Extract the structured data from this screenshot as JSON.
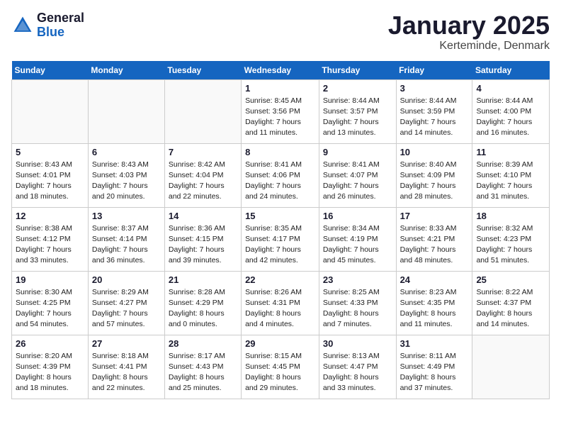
{
  "logo": {
    "general": "General",
    "blue": "Blue"
  },
  "title": "January 2025",
  "location": "Kerteminde, Denmark",
  "weekdays": [
    "Sunday",
    "Monday",
    "Tuesday",
    "Wednesday",
    "Thursday",
    "Friday",
    "Saturday"
  ],
  "weeks": [
    [
      {
        "day": "",
        "text": ""
      },
      {
        "day": "",
        "text": ""
      },
      {
        "day": "",
        "text": ""
      },
      {
        "day": "1",
        "text": "Sunrise: 8:45 AM\nSunset: 3:56 PM\nDaylight: 7 hours\nand 11 minutes."
      },
      {
        "day": "2",
        "text": "Sunrise: 8:44 AM\nSunset: 3:57 PM\nDaylight: 7 hours\nand 13 minutes."
      },
      {
        "day": "3",
        "text": "Sunrise: 8:44 AM\nSunset: 3:59 PM\nDaylight: 7 hours\nand 14 minutes."
      },
      {
        "day": "4",
        "text": "Sunrise: 8:44 AM\nSunset: 4:00 PM\nDaylight: 7 hours\nand 16 minutes."
      }
    ],
    [
      {
        "day": "5",
        "text": "Sunrise: 8:43 AM\nSunset: 4:01 PM\nDaylight: 7 hours\nand 18 minutes."
      },
      {
        "day": "6",
        "text": "Sunrise: 8:43 AM\nSunset: 4:03 PM\nDaylight: 7 hours\nand 20 minutes."
      },
      {
        "day": "7",
        "text": "Sunrise: 8:42 AM\nSunset: 4:04 PM\nDaylight: 7 hours\nand 22 minutes."
      },
      {
        "day": "8",
        "text": "Sunrise: 8:41 AM\nSunset: 4:06 PM\nDaylight: 7 hours\nand 24 minutes."
      },
      {
        "day": "9",
        "text": "Sunrise: 8:41 AM\nSunset: 4:07 PM\nDaylight: 7 hours\nand 26 minutes."
      },
      {
        "day": "10",
        "text": "Sunrise: 8:40 AM\nSunset: 4:09 PM\nDaylight: 7 hours\nand 28 minutes."
      },
      {
        "day": "11",
        "text": "Sunrise: 8:39 AM\nSunset: 4:10 PM\nDaylight: 7 hours\nand 31 minutes."
      }
    ],
    [
      {
        "day": "12",
        "text": "Sunrise: 8:38 AM\nSunset: 4:12 PM\nDaylight: 7 hours\nand 33 minutes."
      },
      {
        "day": "13",
        "text": "Sunrise: 8:37 AM\nSunset: 4:14 PM\nDaylight: 7 hours\nand 36 minutes."
      },
      {
        "day": "14",
        "text": "Sunrise: 8:36 AM\nSunset: 4:15 PM\nDaylight: 7 hours\nand 39 minutes."
      },
      {
        "day": "15",
        "text": "Sunrise: 8:35 AM\nSunset: 4:17 PM\nDaylight: 7 hours\nand 42 minutes."
      },
      {
        "day": "16",
        "text": "Sunrise: 8:34 AM\nSunset: 4:19 PM\nDaylight: 7 hours\nand 45 minutes."
      },
      {
        "day": "17",
        "text": "Sunrise: 8:33 AM\nSunset: 4:21 PM\nDaylight: 7 hours\nand 48 minutes."
      },
      {
        "day": "18",
        "text": "Sunrise: 8:32 AM\nSunset: 4:23 PM\nDaylight: 7 hours\nand 51 minutes."
      }
    ],
    [
      {
        "day": "19",
        "text": "Sunrise: 8:30 AM\nSunset: 4:25 PM\nDaylight: 7 hours\nand 54 minutes."
      },
      {
        "day": "20",
        "text": "Sunrise: 8:29 AM\nSunset: 4:27 PM\nDaylight: 7 hours\nand 57 minutes."
      },
      {
        "day": "21",
        "text": "Sunrise: 8:28 AM\nSunset: 4:29 PM\nDaylight: 8 hours\nand 0 minutes."
      },
      {
        "day": "22",
        "text": "Sunrise: 8:26 AM\nSunset: 4:31 PM\nDaylight: 8 hours\nand 4 minutes."
      },
      {
        "day": "23",
        "text": "Sunrise: 8:25 AM\nSunset: 4:33 PM\nDaylight: 8 hours\nand 7 minutes."
      },
      {
        "day": "24",
        "text": "Sunrise: 8:23 AM\nSunset: 4:35 PM\nDaylight: 8 hours\nand 11 minutes."
      },
      {
        "day": "25",
        "text": "Sunrise: 8:22 AM\nSunset: 4:37 PM\nDaylight: 8 hours\nand 14 minutes."
      }
    ],
    [
      {
        "day": "26",
        "text": "Sunrise: 8:20 AM\nSunset: 4:39 PM\nDaylight: 8 hours\nand 18 minutes."
      },
      {
        "day": "27",
        "text": "Sunrise: 8:18 AM\nSunset: 4:41 PM\nDaylight: 8 hours\nand 22 minutes."
      },
      {
        "day": "28",
        "text": "Sunrise: 8:17 AM\nSunset: 4:43 PM\nDaylight: 8 hours\nand 25 minutes."
      },
      {
        "day": "29",
        "text": "Sunrise: 8:15 AM\nSunset: 4:45 PM\nDaylight: 8 hours\nand 29 minutes."
      },
      {
        "day": "30",
        "text": "Sunrise: 8:13 AM\nSunset: 4:47 PM\nDaylight: 8 hours\nand 33 minutes."
      },
      {
        "day": "31",
        "text": "Sunrise: 8:11 AM\nSunset: 4:49 PM\nDaylight: 8 hours\nand 37 minutes."
      },
      {
        "day": "",
        "text": ""
      }
    ]
  ]
}
